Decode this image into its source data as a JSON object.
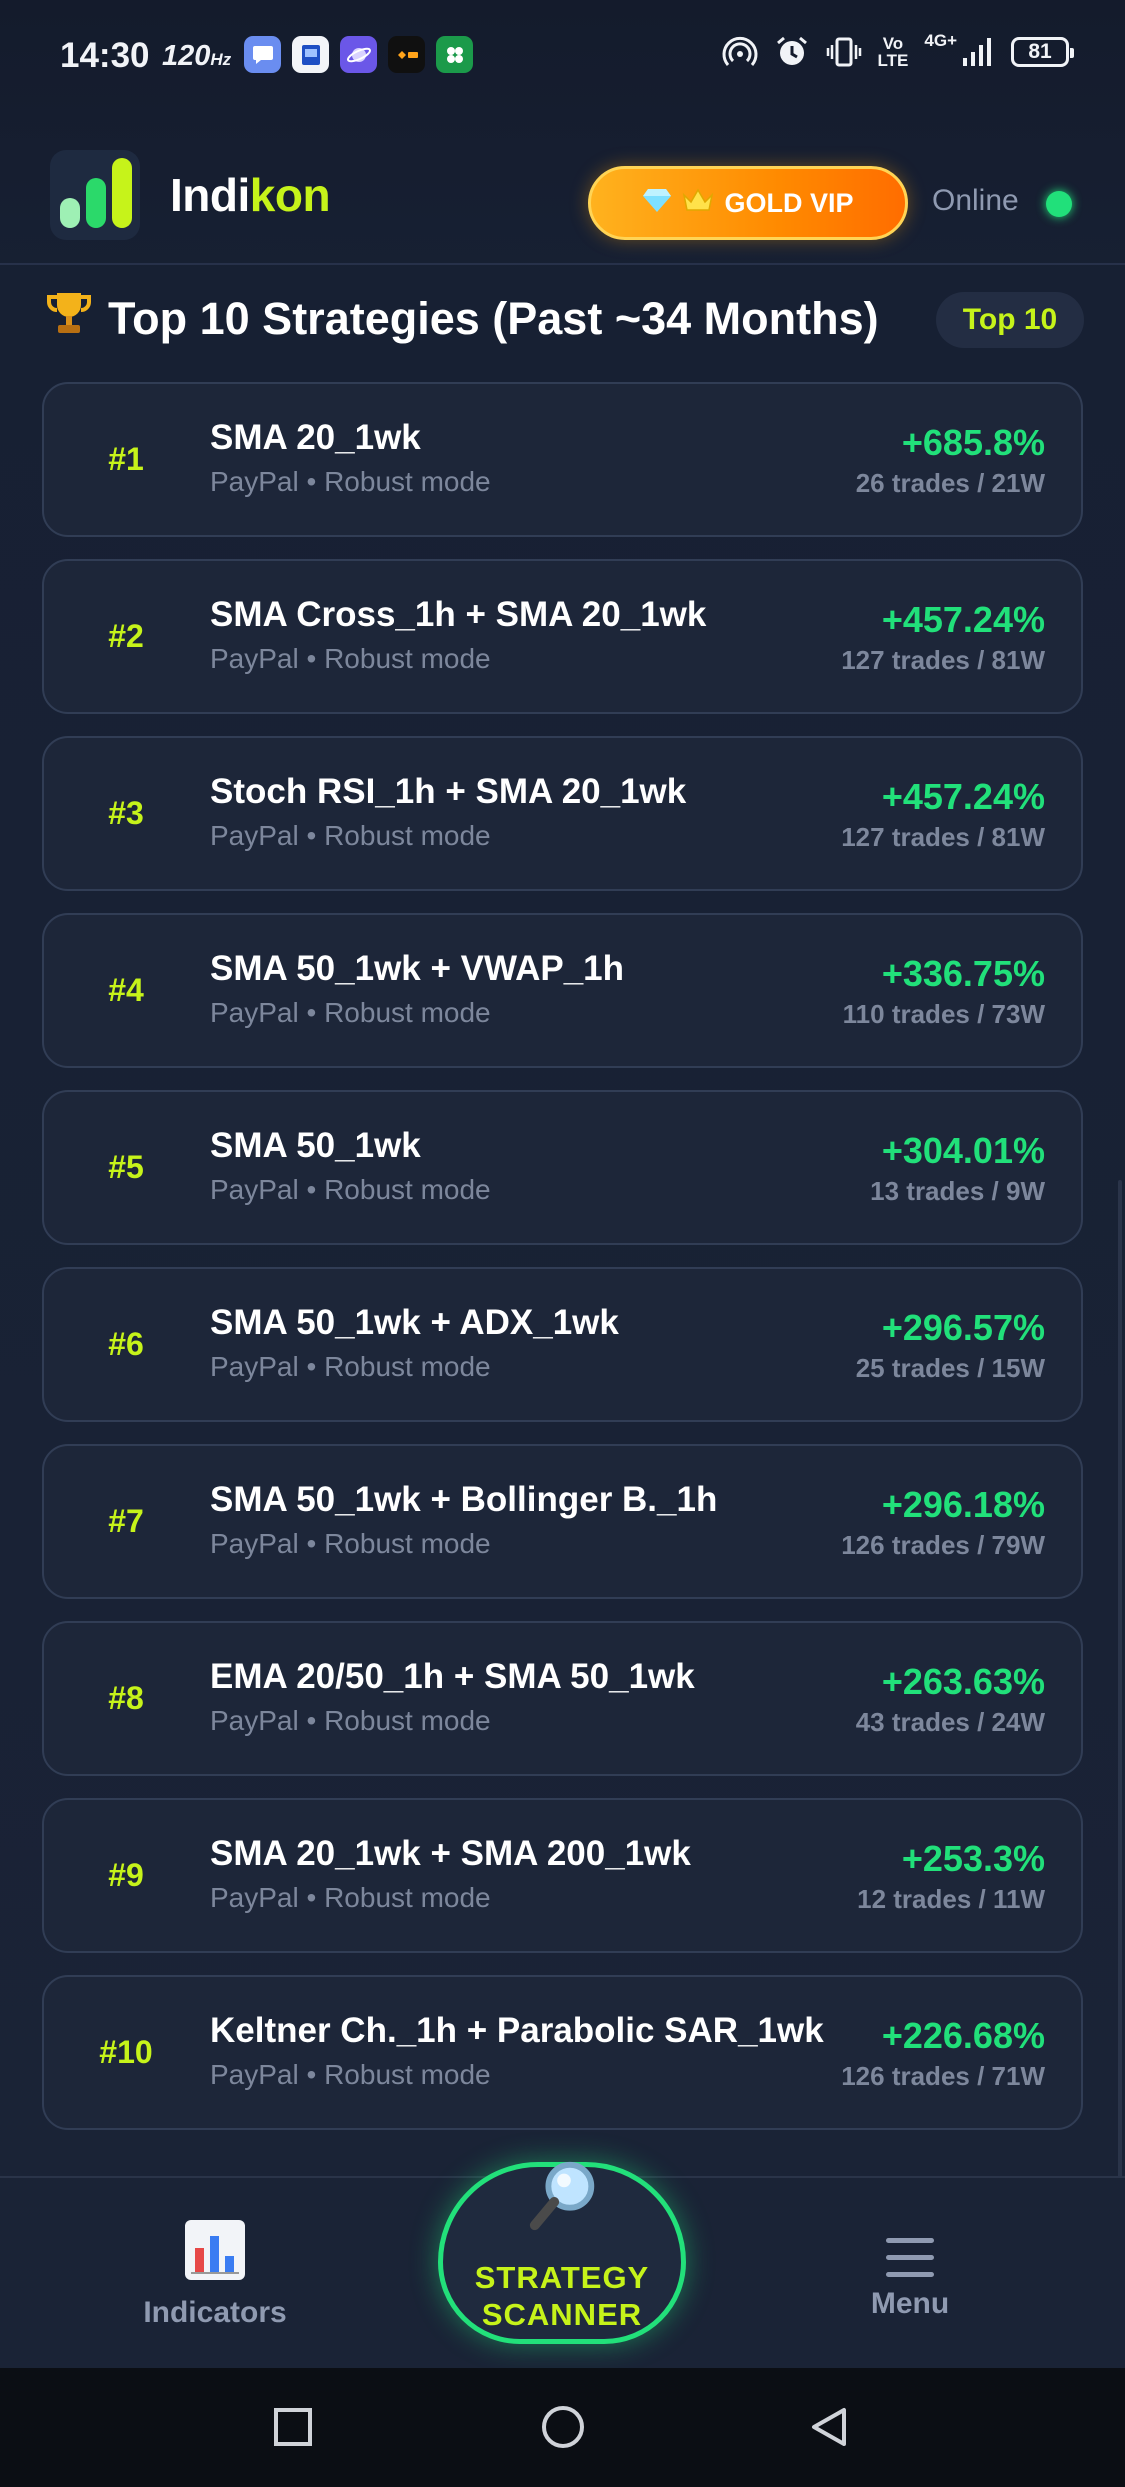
{
  "status_bar": {
    "time": "14:30",
    "refresh_rate": "120",
    "refresh_unit": "Hz",
    "network_volte_top": "Vo",
    "network_volte_bottom": "LTE",
    "network_type": "4G+",
    "battery": "81",
    "app_icons": [
      "chat-bubble-icon",
      "tablet-icon",
      "planet-icon",
      "orange-app-icon",
      "clover-icon"
    ],
    "status_icons": [
      "hotspot-icon",
      "alarm-icon",
      "vibrate-icon",
      "signal-icon"
    ]
  },
  "header": {
    "brand_part1": "Indi",
    "brand_part2": "kon",
    "vip_label": "GOLD VIP",
    "status_label": "Online",
    "accent_color": "#c6f31a",
    "online_color": "#21e07a"
  },
  "section": {
    "title": "Top 10 Strategies (Past ~34 Months)",
    "badge": "Top 10"
  },
  "strategies": [
    {
      "rank": "#1",
      "name": "SMA 20_1wk",
      "sub": "PayPal • Robust mode",
      "pct": "+685.8%",
      "trades": "26 trades / 21W"
    },
    {
      "rank": "#2",
      "name": "SMA Cross_1h + SMA 20_1wk",
      "sub": "PayPal • Robust mode",
      "pct": "+457.24%",
      "trades": "127 trades / 81W"
    },
    {
      "rank": "#3",
      "name": "Stoch RSI_1h + SMA 20_1wk",
      "sub": "PayPal • Robust mode",
      "pct": "+457.24%",
      "trades": "127 trades / 81W"
    },
    {
      "rank": "#4",
      "name": "SMA 50_1wk + VWAP_1h",
      "sub": "PayPal • Robust mode",
      "pct": "+336.75%",
      "trades": "110 trades / 73W"
    },
    {
      "rank": "#5",
      "name": "SMA 50_1wk",
      "sub": "PayPal • Robust mode",
      "pct": "+304.01%",
      "trades": "13 trades / 9W"
    },
    {
      "rank": "#6",
      "name": "SMA 50_1wk + ADX_1wk",
      "sub": "PayPal • Robust mode",
      "pct": "+296.57%",
      "trades": "25 trades / 15W"
    },
    {
      "rank": "#7",
      "name": "SMA 50_1wk + Bollinger B._1h",
      "sub": "PayPal • Robust mode",
      "pct": "+296.18%",
      "trades": "126 trades / 79W"
    },
    {
      "rank": "#8",
      "name": "EMA 20/50_1h + SMA 50_1wk",
      "sub": "PayPal • Robust mode",
      "pct": "+263.63%",
      "trades": "43 trades / 24W"
    },
    {
      "rank": "#9",
      "name": "SMA 20_1wk + SMA 200_1wk",
      "sub": "PayPal • Robust mode",
      "pct": "+253.3%",
      "trades": "12 trades / 11W"
    },
    {
      "rank": "#10",
      "name": "Keltner Ch._1h + Parabolic SAR_1wk",
      "sub": "PayPal • Robust mode",
      "pct": "+226.68%",
      "trades": "126 trades / 71W"
    }
  ],
  "bottom_nav": {
    "indicators_label": "Indicators",
    "scanner_line1": "STRATEGY",
    "scanner_line2": "SCANNER",
    "menu_label": "Menu"
  },
  "system_nav": {
    "buttons": [
      "recent-apps-icon",
      "home-icon",
      "back-icon"
    ]
  }
}
